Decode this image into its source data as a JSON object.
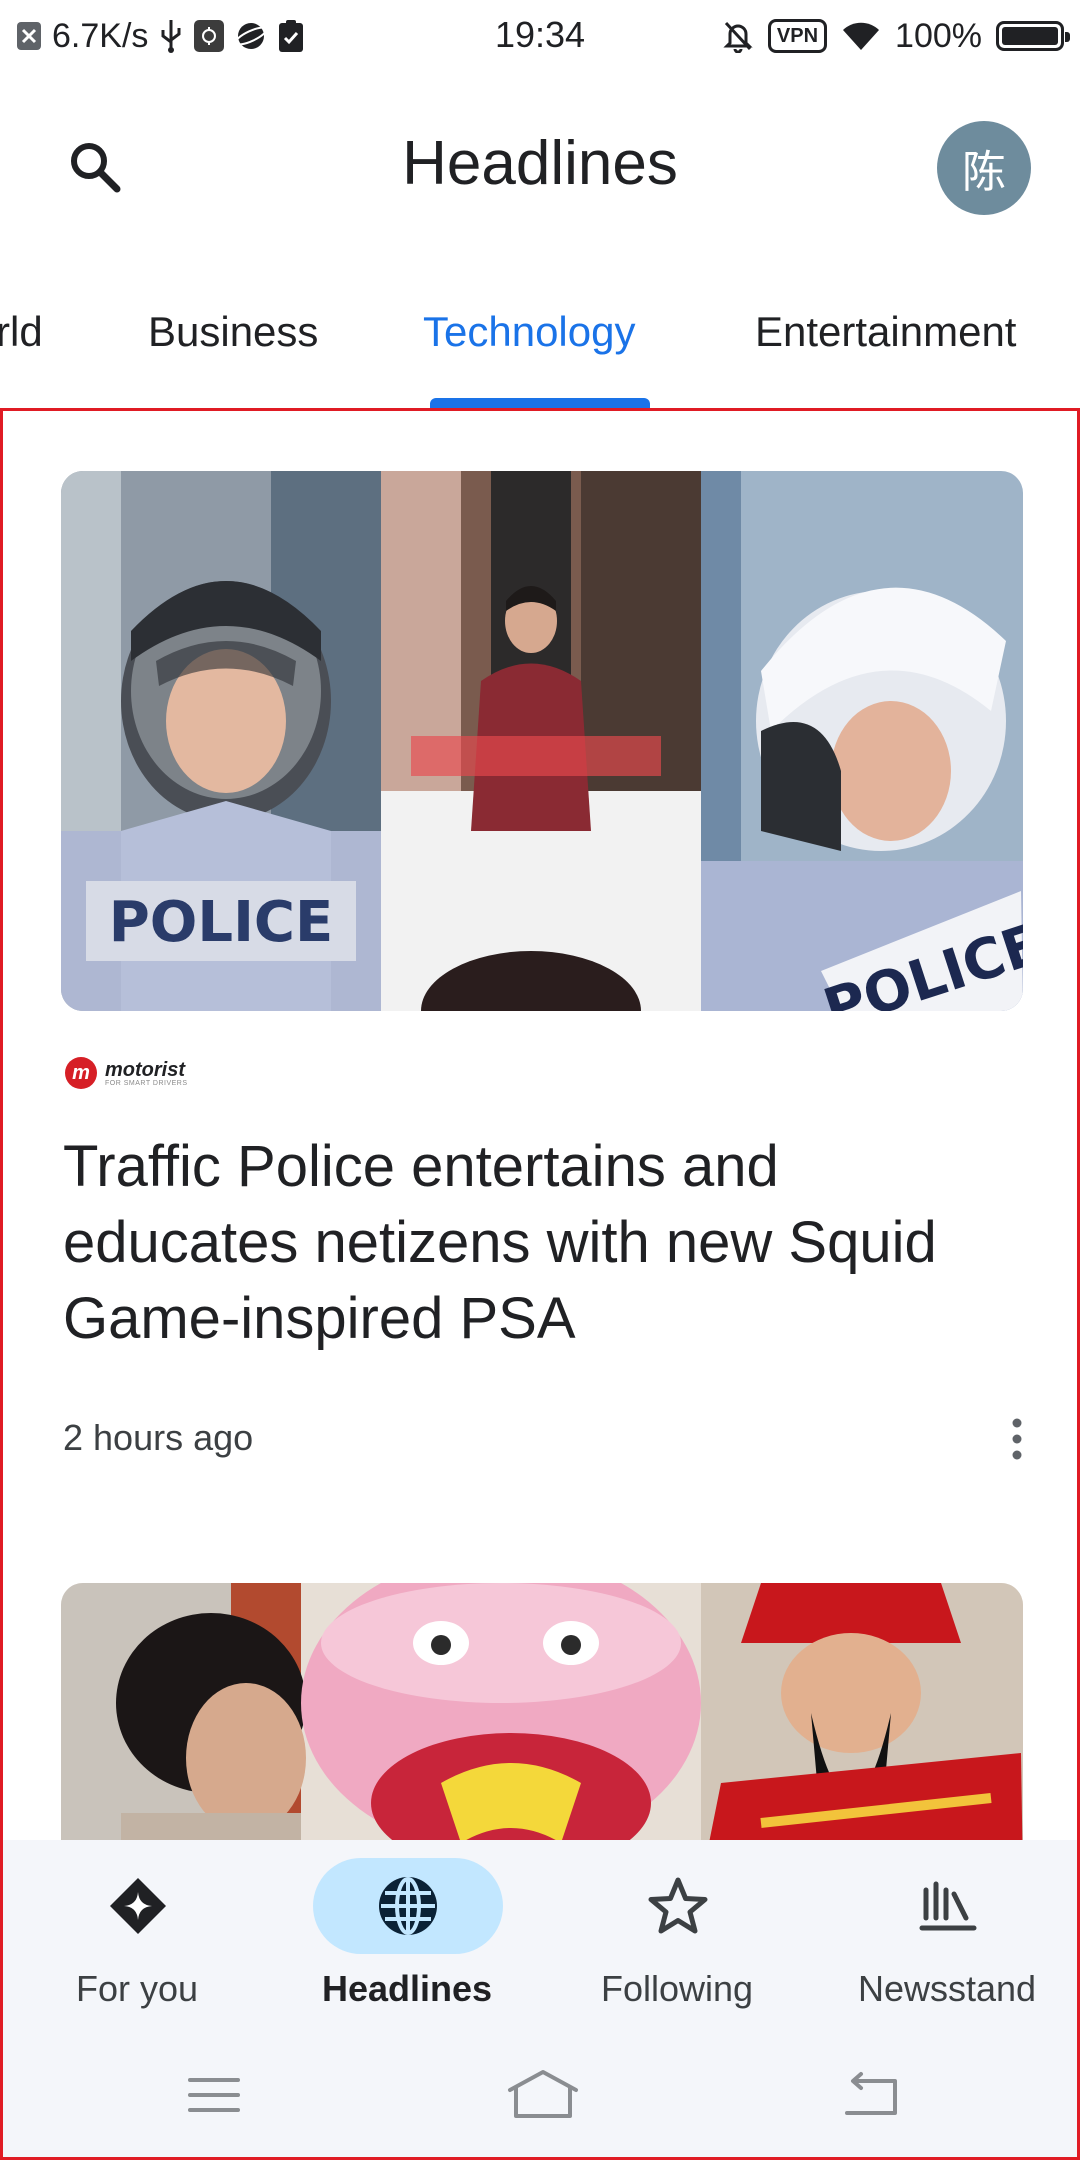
{
  "status_bar": {
    "net_speed": "6.7K/s",
    "time": "19:34",
    "vpn_label": "VPN",
    "battery": "100%",
    "battery_level": 1.0
  },
  "app_bar": {
    "title": "Headlines",
    "avatar_letter": "陈",
    "avatar_color": "#6e8c9d"
  },
  "tabs": [
    {
      "label": "rld",
      "active": false
    },
    {
      "label": "Business",
      "active": false
    },
    {
      "label": "Technology",
      "active": true
    },
    {
      "label": "Entertainment",
      "active": false
    }
  ],
  "story": {
    "publisher": "motorist",
    "publisher_tagline": "FOR SMART DRIVERS",
    "headline": "Traffic Police entertains and educates netizens with new Squid Game-inspired PSA",
    "time": "2 hours ago",
    "image_text_left": "POLICE",
    "image_text_right": "POLICE"
  },
  "bottom_nav": [
    {
      "label": "For you",
      "icon": "for-you-diamond-icon",
      "active": false
    },
    {
      "label": "Headlines",
      "icon": "globe-icon",
      "active": true
    },
    {
      "label": "Following",
      "icon": "star-icon",
      "active": false
    },
    {
      "label": "Newsstand",
      "icon": "newsstand-icon",
      "active": false
    }
  ],
  "colors": {
    "accent": "#1a73e8",
    "active_pill": "#c2e7ff",
    "selection_border": "#e01b24"
  }
}
